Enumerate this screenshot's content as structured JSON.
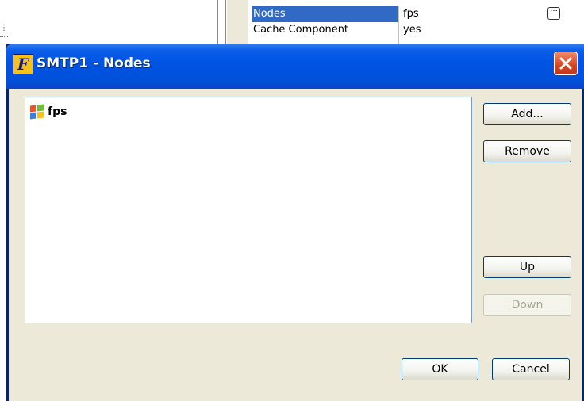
{
  "background_grid": {
    "selected_property": "Nodes",
    "selected_value": "fps",
    "ellipsis_label": "···",
    "next_property": "Cache Component",
    "next_value": "yes"
  },
  "dialog": {
    "icon_letter": "F",
    "title": "SMTP1 - Nodes",
    "nodes": [
      {
        "label": "fps",
        "icon": "windows-flag-icon"
      }
    ],
    "buttons": {
      "add": "Add...",
      "remove": "Remove",
      "up": "Up",
      "down": "Down",
      "ok": "OK",
      "cancel": "Cancel"
    },
    "down_enabled": false
  },
  "colors": {
    "selection": "#316ac5",
    "titlebar": "#0054e3",
    "dialog_face": "#ece9d8",
    "close_button": "#d6451f"
  }
}
